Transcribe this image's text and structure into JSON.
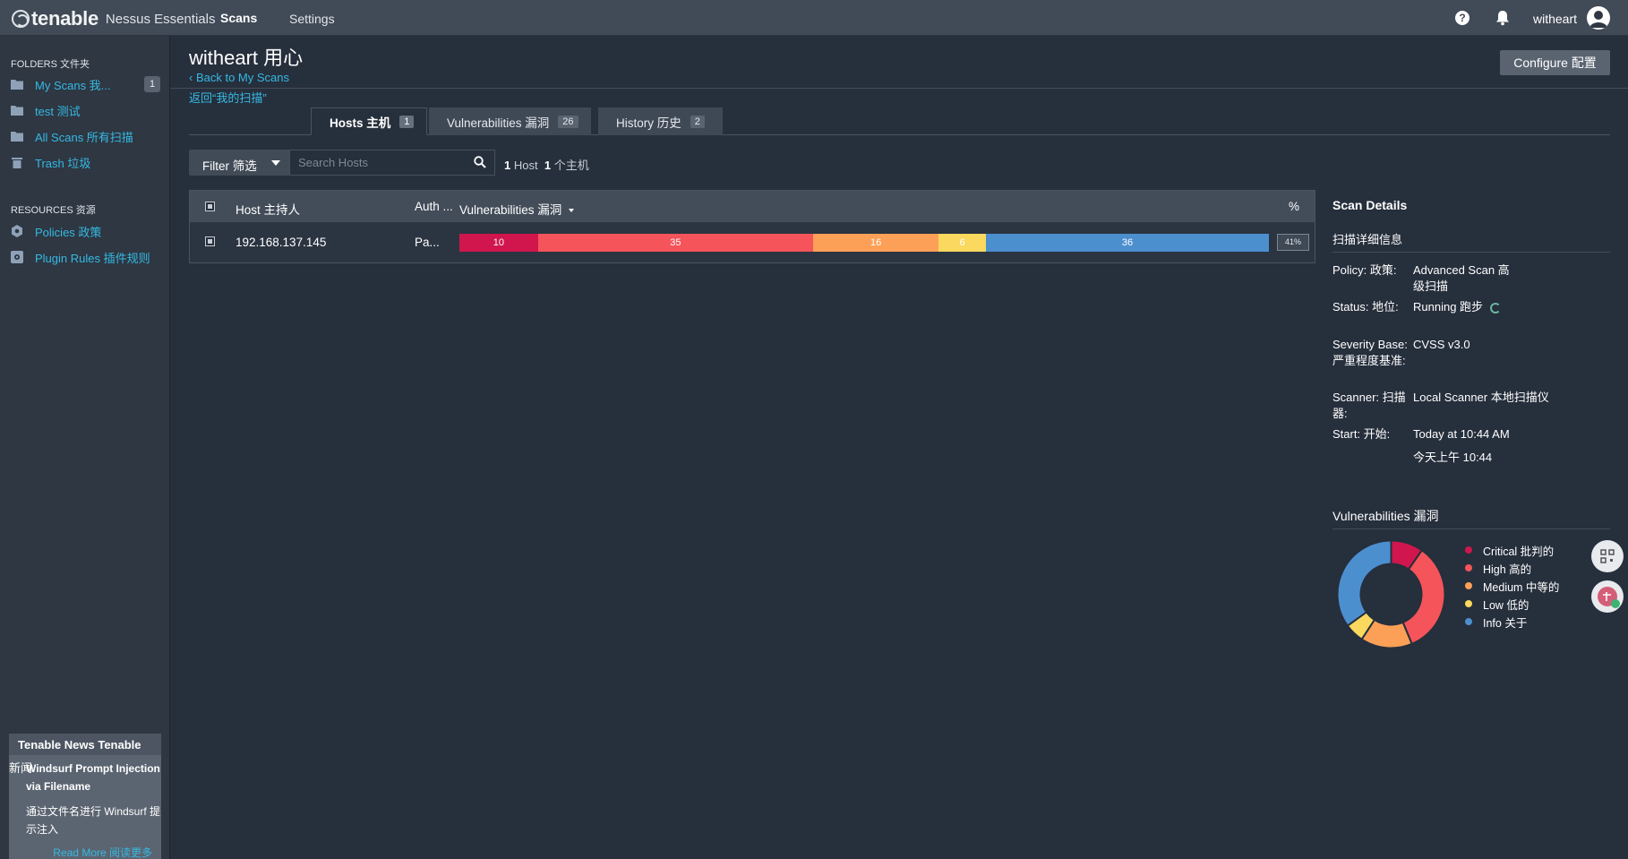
{
  "topbar": {
    "brand": "tenable",
    "product": "Nessus Essentials",
    "nav_scans": "Scans",
    "nav_settings": "Settings",
    "help": "?",
    "user": "witheart"
  },
  "sidebar": {
    "folders_heading": "FOLDERS 文件夹",
    "folders": [
      {
        "label": "My Scans 我...",
        "badge": "1",
        "icon": "folder-icon"
      },
      {
        "label": "test 测试",
        "icon": "folder-icon"
      },
      {
        "label": "All Scans 所有扫描",
        "icon": "folder-icon"
      },
      {
        "label": "Trash 垃圾",
        "icon": "trash-icon"
      }
    ],
    "resources_heading": "RESOURCES 资源",
    "resources": [
      {
        "label": "Policies 政策",
        "icon": "policy-icon"
      },
      {
        "label": "Plugin Rules 插件规则",
        "icon": "plugin-icon"
      }
    ],
    "news": {
      "heading": "Tenable News Tenable",
      "heading_cn": "新闻",
      "title": "Windsurf Prompt Injection via Filename",
      "body": "通过文件名进行 Windsurf 提示注入",
      "read_more": "Read More 阅读更多"
    },
    "collapse": "«"
  },
  "main": {
    "title": "witheart 用心",
    "back": "Back to My Scans",
    "back_cn": "返回“我的扫描”",
    "configure": "Configure 配置",
    "tabs": [
      {
        "label": "Hosts 主机",
        "count": "1"
      },
      {
        "label": "Vulnerabilities 漏洞",
        "count": "26"
      },
      {
        "label": "History 历史",
        "count": "2"
      }
    ],
    "filter": "Filter 筛选",
    "search_placeholder": "Search Hosts",
    "host_count_num": "1",
    "host_count_label": "Host",
    "host_count_num_cn": "1",
    "host_count_label_cn": "个主机"
  },
  "table": {
    "headers": {
      "host": "Host 主持人",
      "auth": "Auth ...",
      "vulns": "Vulnerabilities 漏洞",
      "pct": "%"
    },
    "rows": [
      {
        "host": "192.168.137.145",
        "auth": "Pa...",
        "segments": [
          {
            "value": 10,
            "color": "#d0164d"
          },
          {
            "value": 35,
            "color": "#f4545a"
          },
          {
            "value": 16,
            "color": "#fca057"
          },
          {
            "value": 6,
            "color": "#fbd95e"
          },
          {
            "value": 36,
            "color": "#4c8fcf"
          }
        ],
        "pct": "41%"
      }
    ]
  },
  "details": {
    "title": "Scan Details",
    "subtitle": "扫描详细信息",
    "policy_label": "Policy: 政策:",
    "policy": "Advanced Scan 高级扫描",
    "status_label": "Status: 地位:",
    "status": "Running 跑步",
    "severity_label": "Severity Base: 严重程度基准:",
    "severity": "CVSS v3.0",
    "scanner_label": "Scanner: 扫描器:",
    "scanner": "Local Scanner 本地扫描仪",
    "start_label": "Start: 开始:",
    "start": "Today at 10:44 AM",
    "start_cn": "今天上午 10:44"
  },
  "vuln_panel": {
    "title": "Vulnerabilities",
    "title_cn": "漏洞",
    "legend": [
      {
        "label": "Critical 批判的",
        "value": 10,
        "color": "#d0164d"
      },
      {
        "label": "High 高的",
        "value": 35,
        "color": "#f4545a"
      },
      {
        "label": "Medium 中等的",
        "value": 16,
        "color": "#fca057"
      },
      {
        "label": "Low 低的",
        "value": 6,
        "color": "#fbd95e"
      },
      {
        "label": "Info 关于",
        "value": 36,
        "color": "#4c8fcf"
      }
    ]
  }
}
